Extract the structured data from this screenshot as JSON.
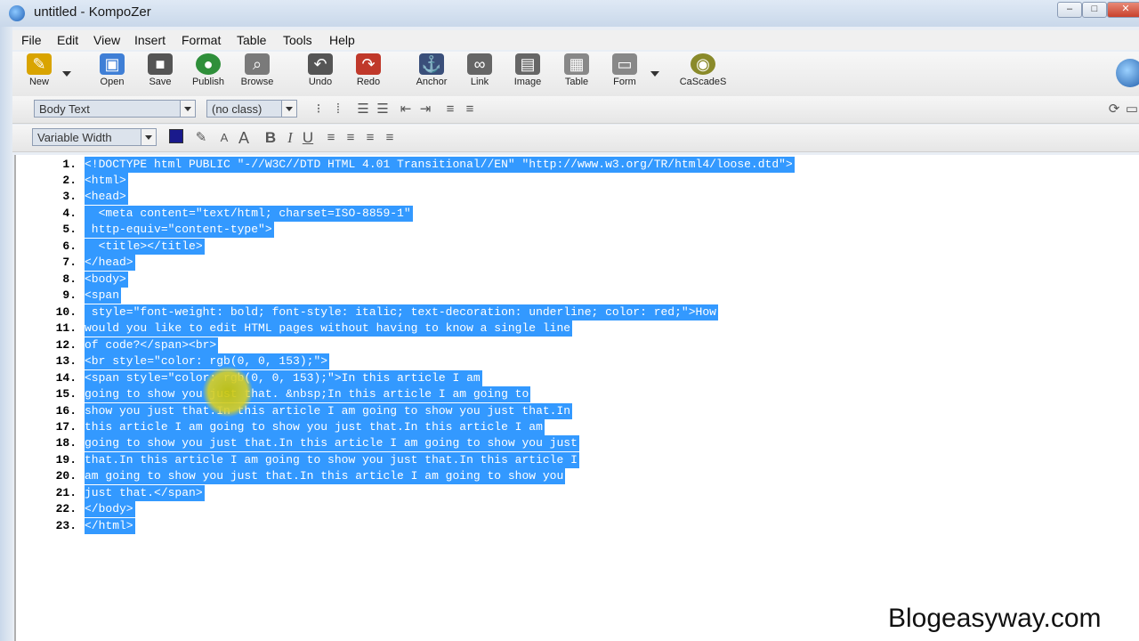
{
  "window": {
    "title": "untitled - KompoZer"
  },
  "menu": [
    "File",
    "Edit",
    "View",
    "Insert",
    "Format",
    "Table",
    "Tools",
    "Help"
  ],
  "toolbar": [
    {
      "label": "New",
      "icon": "pencil-icon",
      "color": "#d9a400"
    },
    {
      "label": "Open",
      "icon": "folder-icon",
      "color": "#3f7fd6"
    },
    {
      "label": "Save",
      "icon": "floppy-icon",
      "color": "#555555"
    },
    {
      "label": "Publish",
      "icon": "globe-icon",
      "color": "#2f8f3a"
    },
    {
      "label": "Browse",
      "icon": "magnifier-icon",
      "color": "#7a7a7a"
    },
    {
      "label": "Undo",
      "icon": "undo-icon",
      "color": "#555555"
    },
    {
      "label": "Redo",
      "icon": "redo-icon",
      "color": "#c0392b"
    },
    {
      "label": "Anchor",
      "icon": "anchor-icon",
      "color": "#3a4f7a"
    },
    {
      "label": "Link",
      "icon": "link-icon",
      "color": "#666666"
    },
    {
      "label": "Image",
      "icon": "image-icon",
      "color": "#666666"
    },
    {
      "label": "Table",
      "icon": "table-icon",
      "color": "#888888"
    },
    {
      "label": "Form",
      "icon": "form-icon",
      "color": "#888888"
    },
    {
      "label": "CaScadeS",
      "icon": "css-icon",
      "color": "#8a8a2a"
    }
  ],
  "format1": {
    "paragraph_style": "Body Text",
    "class_select": "(no class)"
  },
  "format2": {
    "font_select": "Variable Width",
    "text_color": "#1a1a8c"
  },
  "code_lines": [
    {
      "n": "1.",
      "t": "<!DOCTYPE html PUBLIC \"-//W3C//DTD HTML 4.01 Transitional//EN\" \"http://www.w3.org/TR/html4/loose.dtd\">"
    },
    {
      "n": "2.",
      "t": "<html>"
    },
    {
      "n": "3.",
      "t": "<head>"
    },
    {
      "n": "4.",
      "t": "  <meta content=\"text/html; charset=ISO-8859-1\""
    },
    {
      "n": "5.",
      "t": " http-equiv=\"content-type\">"
    },
    {
      "n": "6.",
      "t": "  <title></title>"
    },
    {
      "n": "7.",
      "t": "</head>"
    },
    {
      "n": "8.",
      "t": "<body>"
    },
    {
      "n": "9.",
      "t": "<span"
    },
    {
      "n": "10.",
      "t": " style=\"font-weight: bold; font-style: italic; text-decoration: underline; color: red;\">How"
    },
    {
      "n": "11.",
      "t": "would you like to edit HTML pages without having to know a single line"
    },
    {
      "n": "12.",
      "t": "of code?</span><br>"
    },
    {
      "n": "13.",
      "t": "<br style=\"color: rgb(0, 0, 153);\">"
    },
    {
      "n": "14.",
      "t": "<span style=\"color: rgb(0, 0, 153);\">In this article I am"
    },
    {
      "n": "15.",
      "t": "going to show you just that. &nbsp;In this article I am going to"
    },
    {
      "n": "16.",
      "t": "show you just that.In this article I am going to show you just that.In"
    },
    {
      "n": "17.",
      "t": "this article I am going to show you just that.In this article I am"
    },
    {
      "n": "18.",
      "t": "going to show you just that.In this article I am going to show you just"
    },
    {
      "n": "19.",
      "t": "that.In this article I am going to show you just that.In this article I"
    },
    {
      "n": "20.",
      "t": "am going to show you just that.In this article I am going to show you"
    },
    {
      "n": "21.",
      "t": "just that.</span>"
    },
    {
      "n": "22.",
      "t": "</body>"
    },
    {
      "n": "23.",
      "t": "</html>"
    }
  ],
  "colors": {
    "selection": "#3399ff",
    "selection_text": "#ffffff"
  },
  "watermark": "Blogeasyway.com"
}
